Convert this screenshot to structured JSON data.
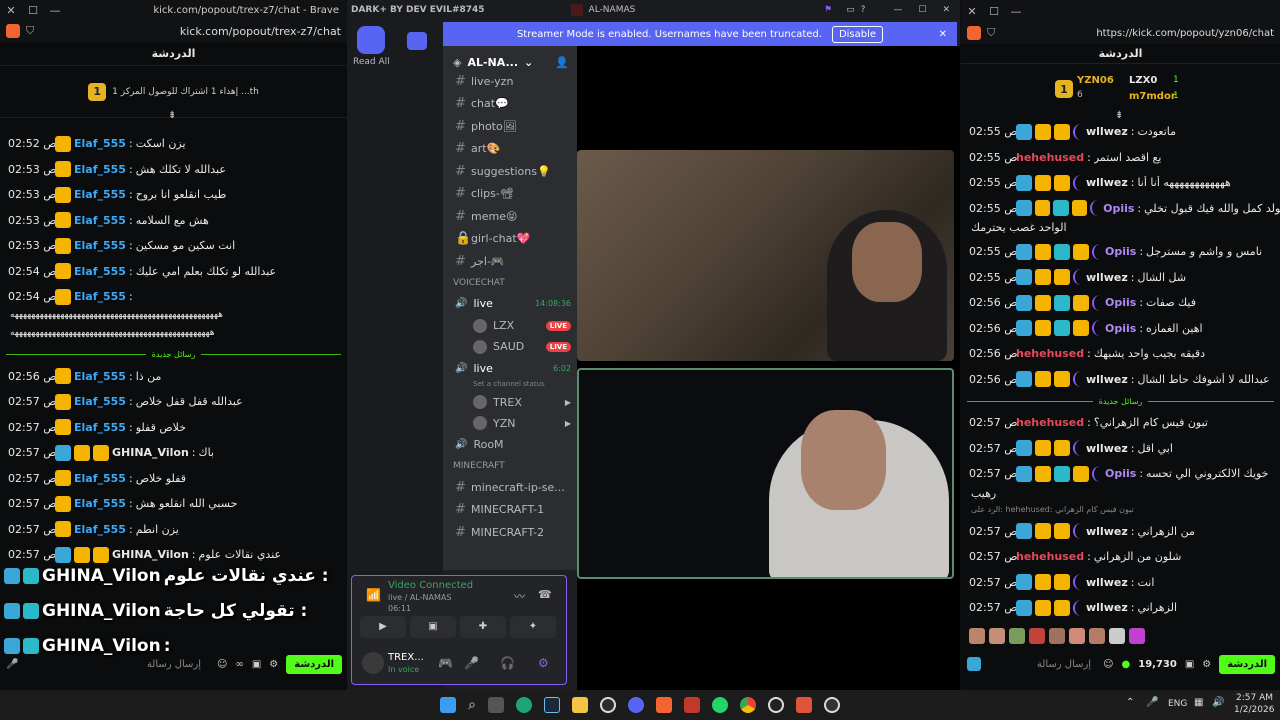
{
  "left_window": {
    "title": "kick.com/popout/trex-z7/chat - Brave",
    "url": "kick.com/popout/trex-z7/chat",
    "header": "الدردشة",
    "goal_text": "إهداء 1 اشتراك للوصول المركز 1 ...th",
    "goal_rank": "1",
    "messages": [
      {
        "time": "02:52 ص",
        "user": "Elaf_555",
        "color": "#3da9f5",
        "text": "يزن اسكت",
        "badges": [
          "crown"
        ]
      },
      {
        "time": "02:53 ص",
        "user": "Elaf_555",
        "color": "#3da9f5",
        "text": "عبدالله لا تكلك هش",
        "badges": [
          "crown"
        ]
      },
      {
        "time": "02:53 ص",
        "user": "Elaf_555",
        "color": "#3da9f5",
        "text": "طيب انقلعو انا بروح",
        "badges": [
          "crown"
        ]
      },
      {
        "time": "02:53 ص",
        "user": "Elaf_555",
        "color": "#3da9f5",
        "text": "هش مع السلامه",
        "badges": [
          "crown"
        ]
      },
      {
        "time": "02:53 ص",
        "user": "Elaf_555",
        "color": "#3da9f5",
        "text": "انت سكين مو مسكين",
        "badges": [
          "crown"
        ]
      },
      {
        "time": "02:54 ص",
        "user": "Elaf_555",
        "color": "#3da9f5",
        "text": "عبدالله لو تكلك بعلم امي عليك",
        "badges": [
          "crown"
        ]
      },
      {
        "time": "02:54 ص",
        "user": "Elaf_555",
        "color": "#3da9f5",
        "text": "",
        "badges": [
          "crown"
        ]
      }
    ],
    "long_line_1": "ههههههههههههههههههههههههههههههههههههههههههههههههههه",
    "long_line_2": "ههههههههههههههههههههههههههههههههههههههههههههههههه",
    "new_messages_label": "رسائل جديدة",
    "messages_after": [
      {
        "time": "02:56 ص",
        "user": "Elaf_555",
        "color": "#3da9f5",
        "text": "من ذا",
        "badges": [
          "crown"
        ]
      },
      {
        "time": "02:57 ص",
        "user": "Elaf_555",
        "color": "#3da9f5",
        "text": "عبدالله قفل قفل خلاص",
        "badges": [
          "crown"
        ]
      },
      {
        "time": "02:57 ص",
        "user": "Elaf_555",
        "color": "#3da9f5",
        "text": "خلاص قفلو",
        "badges": [
          "crown"
        ]
      },
      {
        "time": "02:57 ص",
        "user": "GHINA_Vilon",
        "color": "#e8e8e8",
        "text": "باك",
        "badges": [
          "pick",
          "crown",
          "crown"
        ]
      },
      {
        "time": "02:57 ص",
        "user": "Elaf_555",
        "color": "#3da9f5",
        "text": "قفلو خلاص",
        "badges": [
          "crown"
        ]
      },
      {
        "time": "02:57 ص",
        "user": "Elaf_555",
        "color": "#3da9f5",
        "text": "حسبي الله انقلعو هش",
        "badges": [
          "crown"
        ]
      },
      {
        "time": "02:57 ص",
        "user": "Elaf_555",
        "color": "#3da9f5",
        "text": "يزن انطم",
        "badges": [
          "crown"
        ]
      },
      {
        "time": "02:57 ص",
        "user": "GHINA_Vilon",
        "color": "#e8e8e8",
        "text": "عندي نقالات علوم",
        "badges": [
          "pick",
          "crown",
          "crown"
        ]
      }
    ],
    "overlay": [
      {
        "user": "GHINA_Vilon",
        "text": "عندي نقالات علوم :"
      },
      {
        "user": "GHINA_Vilon",
        "text": "تقولي كل حاجة :"
      },
      {
        "user": "GHINA_Vilon",
        "text": ":"
      }
    ],
    "input_placeholder": "إرسال رسالة",
    "send_label": "الدردشة"
  },
  "discord": {
    "title": "DARK+ BY DEV EVIL#8745",
    "server_title": "AL-NAMAS",
    "read_all": "Read All",
    "banner_text": "Streamer Mode is enabled. Usernames have been truncated.",
    "banner_button": "Disable",
    "server_name": "AL-NA...",
    "channels": [
      {
        "name": "live-yzn",
        "icon": "#"
      },
      {
        "name": "chat💬",
        "icon": "#"
      },
      {
        "name": "photo🖼",
        "icon": "#"
      },
      {
        "name": "art🎨",
        "icon": "#"
      },
      {
        "name": "suggestions💡",
        "icon": "#"
      },
      {
        "name": "clips-📽",
        "icon": "#"
      },
      {
        "name": "meme😝",
        "icon": "#"
      },
      {
        "name": "girl-chat💖",
        "icon": "🔒"
      },
      {
        "name": "اجر-🎮",
        "icon": "#"
      }
    ],
    "voice_category": "VOICECHAT",
    "voice_live1": "live",
    "voice_live1_time": "14:08:36",
    "voice_users1": [
      {
        "name": "LZX",
        "live": "LIVE"
      },
      {
        "name": "SAUD",
        "live": "LIVE"
      }
    ],
    "voice_live2": "live",
    "voice_live2_time": "6:02",
    "voice_status": "Set a channel status",
    "voice_users2": [
      {
        "name": "TREX"
      },
      {
        "name": "YZN"
      }
    ],
    "room": "RooM",
    "mc_category": "MINECRAFT",
    "mc_channels": [
      "minecraft-ip-se...",
      "MINECRAFT-1",
      "MINECRAFT-2"
    ],
    "video_connected": "Video Connected",
    "video_sub": "live / AL-NAMAS",
    "video_time": "06:11",
    "self_name": "TREX...",
    "self_status": "In voice",
    "server_badges": [
      "KRM",
      "B-7s",
      "MT"
    ],
    "badge_count": "1"
  },
  "right_window": {
    "url": "https://kick.com/popout/yzn06/chat",
    "header": "الدردشة",
    "top_users": [
      {
        "name": "YZN06",
        "count": "6",
        "rank": "1"
      },
      {
        "name": "LZX0",
        "count": "1"
      },
      {
        "name": "m7mdor",
        "count": "1"
      }
    ],
    "messages": [
      {
        "time": "02:55 ص",
        "user": "wllwez",
        "color": "#e8e8e8",
        "text": "ماتعودت",
        "badges": [
          "pick",
          "crown",
          "crown",
          "moon"
        ]
      },
      {
        "time": "02:55 ص",
        "user": "hehehused",
        "color": "#e8495a",
        "text": "يع اقصد استمر",
        "badges": []
      },
      {
        "time": "02:55 ص",
        "user": "wllwez",
        "color": "#e8e8e8",
        "text": "ههههههههههههه أنا أنا",
        "badges": [
          "pick",
          "crown",
          "crown",
          "moon"
        ]
      },
      {
        "time": "02:55 ص",
        "user": "Opiis",
        "color": "#b089f5",
        "text": "يولد كمل والله فيك قبول تخلي",
        "badges": [
          "pick",
          "crown",
          "og",
          "crown",
          "moon"
        ]
      }
    ],
    "wrap_line": "الواحد غصب يحترمك",
    "messages2": [
      {
        "time": "02:55 ص",
        "user": "Opiis",
        "color": "#b089f5",
        "text": "نامس و واشم و مسترجل",
        "badges": [
          "pick",
          "crown",
          "og",
          "crown",
          "moon"
        ]
      },
      {
        "time": "02:55 ص",
        "user": "wllwez",
        "color": "#e8e8e8",
        "text": "شل الشال",
        "badges": [
          "pick",
          "crown",
          "crown",
          "moon"
        ]
      },
      {
        "time": "02:56 ص",
        "user": "Opiis",
        "color": "#b089f5",
        "text": "فيك صفات",
        "badges": [
          "pick",
          "crown",
          "og",
          "crown",
          "moon"
        ]
      },
      {
        "time": "02:56 ص",
        "user": "Opiis",
        "color": "#b089f5",
        "text": "اهين الغمازه",
        "badges": [
          "pick",
          "crown",
          "og",
          "crown",
          "moon"
        ]
      },
      {
        "time": "02:56 ص",
        "user": "hehehused",
        "color": "#e8495a",
        "text": "دقيقه بجيب واحد يشبهك",
        "badges": []
      },
      {
        "time": "02:56 ص",
        "user": "wllwez",
        "color": "#e8e8e8",
        "text": "عبدالله لا أشوفك حاط الشال",
        "badges": [
          "pick",
          "crown",
          "crown",
          "moon"
        ]
      }
    ],
    "new_messages_label": "رسائل جديدة",
    "messages3": [
      {
        "time": "02:57 ص",
        "user": "hehehused",
        "color": "#e8495a",
        "text": "تبون فيس كام الزهراني؟",
        "badges": []
      },
      {
        "time": "02:57 ص",
        "user": "wllwez",
        "color": "#e8e8e8",
        "text": "ابي اقل",
        "badges": [
          "pick",
          "crown",
          "crown",
          "moon"
        ]
      },
      {
        "time": "02:57 ص",
        "user": "Opiis",
        "color": "#b089f5",
        "text": "خويك الالكتروني الي تحسه",
        "badges": [
          "pick",
          "crown",
          "og",
          "crown",
          "moon"
        ]
      }
    ],
    "wrap_line2": "رهيب",
    "reply_line": "الرد على: hehehused: تبون فيس كام الزهراني",
    "messages4": [
      {
        "time": "02:57 ص",
        "user": "wllwez",
        "color": "#e8e8e8",
        "text": "من الزهراني",
        "badges": [
          "pick",
          "crown",
          "crown",
          "moon"
        ]
      },
      {
        "time": "02:57 ص",
        "user": "hehehused",
        "color": "#e8495a",
        "text": "شلون من الزهراني",
        "badges": []
      },
      {
        "time": "02:57 ص",
        "user": "wllwez",
        "color": "#e8e8e8",
        "text": "انت",
        "badges": [
          "pick",
          "crown",
          "crown",
          "moon"
        ]
      },
      {
        "time": "02:57 ص",
        "user": "wllwez",
        "color": "#e8e8e8",
        "text": "الزهراني",
        "badges": [
          "pick",
          "crown",
          "crown",
          "moon"
        ]
      }
    ],
    "input_placeholder": "إرسال رسالة",
    "points": "19,730",
    "send_label": "الدردشة"
  },
  "taskbar": {
    "lang": "ENG",
    "time": "2:57 AM",
    "date": "1/2/2026"
  },
  "colors": {
    "kick_green": "#53fc18",
    "discord_blurple": "#5865f2",
    "live_red": "#ed4245"
  }
}
